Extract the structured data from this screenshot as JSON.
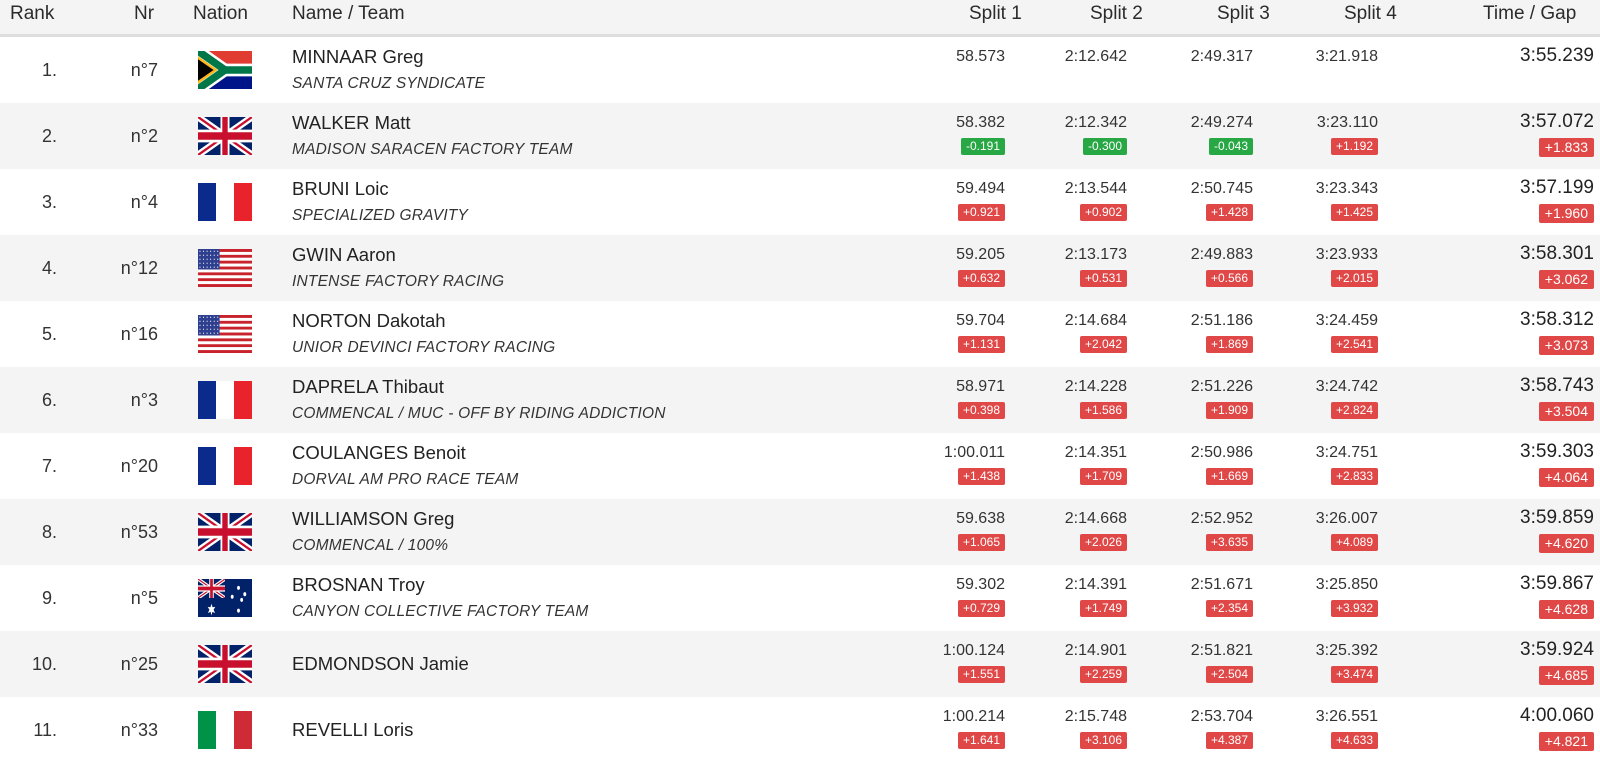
{
  "columns": {
    "rank": "Rank",
    "nr": "Nr",
    "nation": "Nation",
    "name": "Name / Team",
    "split1": "Split 1",
    "split2": "Split 2",
    "split3": "Split 3",
    "split4": "Split 4",
    "time": "Time / Gap"
  },
  "rows": [
    {
      "rank": "1.",
      "nr": "n°7",
      "nation": "south-africa-flag",
      "name": "MINNAAR Greg",
      "team": "SANTA CRUZ SYNDICATE",
      "splits": [
        {
          "v": "58.573",
          "g": ""
        },
        {
          "v": "2:12.642",
          "g": ""
        },
        {
          "v": "2:49.317",
          "g": ""
        },
        {
          "v": "3:21.918",
          "g": ""
        }
      ],
      "time": "3:55.239",
      "gap": ""
    },
    {
      "rank": "2.",
      "nr": "n°2",
      "nation": "uk-flag",
      "name": "WALKER Matt",
      "team": "MADISON SARACEN FACTORY TEAM",
      "splits": [
        {
          "v": "58.382",
          "g": "-0.191"
        },
        {
          "v": "2:12.342",
          "g": "-0.300"
        },
        {
          "v": "2:49.274",
          "g": "-0.043"
        },
        {
          "v": "3:23.110",
          "g": "+1.192"
        }
      ],
      "time": "3:57.072",
      "gap": "+1.833"
    },
    {
      "rank": "3.",
      "nr": "n°4",
      "nation": "france-flag",
      "name": "BRUNI Loic",
      "team": "SPECIALIZED GRAVITY",
      "splits": [
        {
          "v": "59.494",
          "g": "+0.921"
        },
        {
          "v": "2:13.544",
          "g": "+0.902"
        },
        {
          "v": "2:50.745",
          "g": "+1.428"
        },
        {
          "v": "3:23.343",
          "g": "+1.425"
        }
      ],
      "time": "3:57.199",
      "gap": "+1.960"
    },
    {
      "rank": "4.",
      "nr": "n°12",
      "nation": "usa-flag",
      "name": "GWIN Aaron",
      "team": "INTENSE FACTORY RACING",
      "splits": [
        {
          "v": "59.205",
          "g": "+0.632"
        },
        {
          "v": "2:13.173",
          "g": "+0.531"
        },
        {
          "v": "2:49.883",
          "g": "+0.566"
        },
        {
          "v": "3:23.933",
          "g": "+2.015"
        }
      ],
      "time": "3:58.301",
      "gap": "+3.062"
    },
    {
      "rank": "5.",
      "nr": "n°16",
      "nation": "usa-flag",
      "name": "NORTON Dakotah",
      "team": "UNIOR DEVINCI FACTORY RACING",
      "splits": [
        {
          "v": "59.704",
          "g": "+1.131"
        },
        {
          "v": "2:14.684",
          "g": "+2.042"
        },
        {
          "v": "2:51.186",
          "g": "+1.869"
        },
        {
          "v": "3:24.459",
          "g": "+2.541"
        }
      ],
      "time": "3:58.312",
      "gap": "+3.073"
    },
    {
      "rank": "6.",
      "nr": "n°3",
      "nation": "france-flag",
      "name": "DAPRELA Thibaut",
      "team": "COMMENCAL / MUC - OFF BY RIDING ADDICTION",
      "splits": [
        {
          "v": "58.971",
          "g": "+0.398"
        },
        {
          "v": "2:14.228",
          "g": "+1.586"
        },
        {
          "v": "2:51.226",
          "g": "+1.909"
        },
        {
          "v": "3:24.742",
          "g": "+2.824"
        }
      ],
      "time": "3:58.743",
      "gap": "+3.504"
    },
    {
      "rank": "7.",
      "nr": "n°20",
      "nation": "france-flag",
      "name": "COULANGES Benoit",
      "team": "DORVAL AM PRO RACE TEAM",
      "splits": [
        {
          "v": "1:00.011",
          "g": "+1.438"
        },
        {
          "v": "2:14.351",
          "g": "+1.709"
        },
        {
          "v": "2:50.986",
          "g": "+1.669"
        },
        {
          "v": "3:24.751",
          "g": "+2.833"
        }
      ],
      "time": "3:59.303",
      "gap": "+4.064"
    },
    {
      "rank": "8.",
      "nr": "n°53",
      "nation": "uk-flag",
      "name": "WILLIAMSON Greg",
      "team": "COMMENCAL / 100%",
      "splits": [
        {
          "v": "59.638",
          "g": "+1.065"
        },
        {
          "v": "2:14.668",
          "g": "+2.026"
        },
        {
          "v": "2:52.952",
          "g": "+3.635"
        },
        {
          "v": "3:26.007",
          "g": "+4.089"
        }
      ],
      "time": "3:59.859",
      "gap": "+4.620"
    },
    {
      "rank": "9.",
      "nr": "n°5",
      "nation": "australia-flag",
      "name": "BROSNAN Troy",
      "team": "CANYON COLLECTIVE FACTORY TEAM",
      "splits": [
        {
          "v": "59.302",
          "g": "+0.729"
        },
        {
          "v": "2:14.391",
          "g": "+1.749"
        },
        {
          "v": "2:51.671",
          "g": "+2.354"
        },
        {
          "v": "3:25.850",
          "g": "+3.932"
        }
      ],
      "time": "3:59.867",
      "gap": "+4.628"
    },
    {
      "rank": "10.",
      "nr": "n°25",
      "nation": "uk-flag",
      "name": "EDMONDSON Jamie",
      "team": "",
      "splits": [
        {
          "v": "1:00.124",
          "g": "+1.551"
        },
        {
          "v": "2:14.901",
          "g": "+2.259"
        },
        {
          "v": "2:51.821",
          "g": "+2.504"
        },
        {
          "v": "3:25.392",
          "g": "+3.474"
        }
      ],
      "time": "3:59.924",
      "gap": "+4.685"
    },
    {
      "rank": "11.",
      "nr": "n°33",
      "nation": "italy-flag",
      "name": "REVELLI Loris",
      "team": "",
      "splits": [
        {
          "v": "1:00.214",
          "g": "+1.641"
        },
        {
          "v": "2:15.748",
          "g": "+3.106"
        },
        {
          "v": "2:53.704",
          "g": "+4.387"
        },
        {
          "v": "3:26.551",
          "g": "+4.633"
        }
      ],
      "time": "4:00.060",
      "gap": "+4.821"
    }
  ],
  "colors": {
    "gap_positive": "#e04848",
    "gap_negative": "#28a745",
    "row_alt": "#f4f4f4"
  }
}
